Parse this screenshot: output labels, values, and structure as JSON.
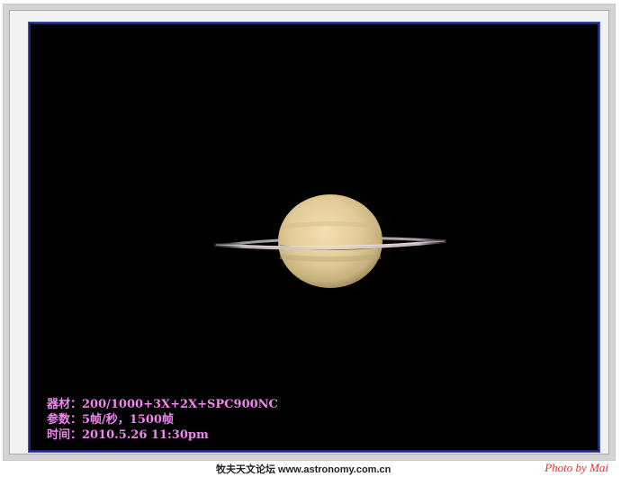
{
  "caption": {
    "line1": "器材：200/1000+3X+2X+SPC900NC",
    "line2": "参数：5帧/秒，1500帧",
    "line3": "时间：2010.5.26 11:30pm"
  },
  "footer": {
    "site": "牧夫天文论坛 www.astronomy.com.cn",
    "credit": "Photo by Mai"
  },
  "colors": {
    "background": "#000000",
    "caption": "#ee88ee",
    "credit": "#e03030",
    "photo_border": "#1d2a6e"
  }
}
